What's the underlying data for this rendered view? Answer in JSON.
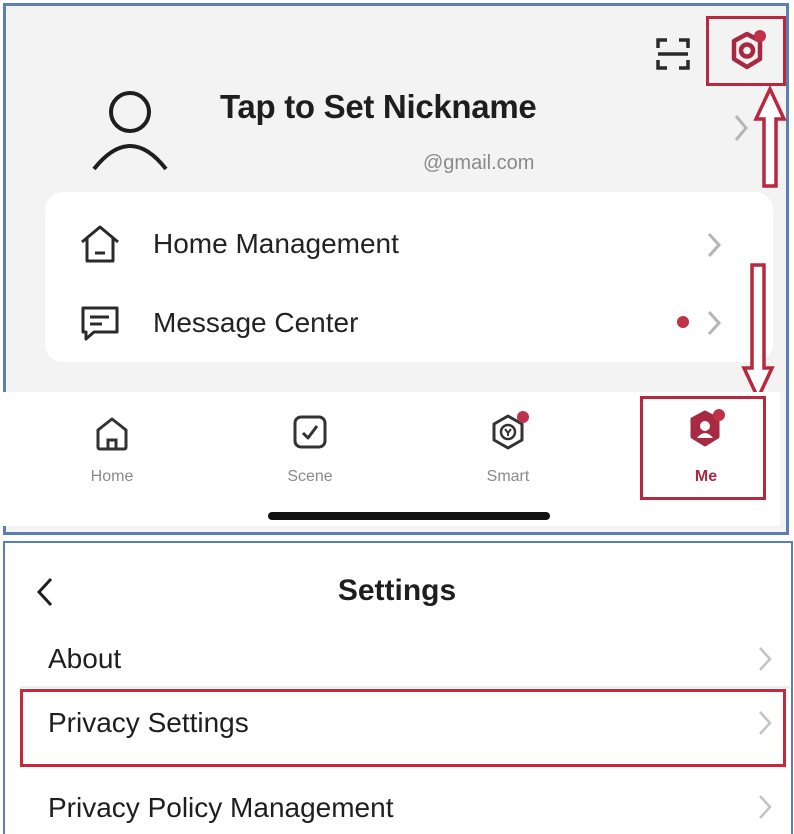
{
  "profile": {
    "nickname": "Tap to Set Nickname",
    "email": "@gmail.com",
    "icons": [
      "user-avatar-icon",
      "scan-icon",
      "settings-gear-icon",
      "chevron-right-icon"
    ]
  },
  "menu": [
    {
      "label": "Home Management",
      "icon": "house-icon",
      "has_dot": false
    },
    {
      "label": "Message Center",
      "icon": "message-icon",
      "has_dot": true
    }
  ],
  "tabbar": {
    "tabs": [
      {
        "label": "Home",
        "icon": "home-icon",
        "active": false
      },
      {
        "label": "Scene",
        "icon": "scene-checkbox-icon",
        "active": false
      },
      {
        "label": "Smart",
        "icon": "smart-cube-icon",
        "active": false,
        "badge": true
      },
      {
        "label": "Me",
        "icon": "me-avatar-icon",
        "active": true,
        "badge": true
      }
    ]
  },
  "settings": {
    "title": "Settings",
    "items": [
      {
        "label": "About"
      },
      {
        "label": "Privacy Settings",
        "highlighted": true
      },
      {
        "label": "Privacy Policy Management"
      }
    ]
  },
  "colors": {
    "highlight": "#b8283f",
    "accent": "#a82a42",
    "panel_border": "#5c7fb3",
    "notification_dot": "#c0314a"
  }
}
